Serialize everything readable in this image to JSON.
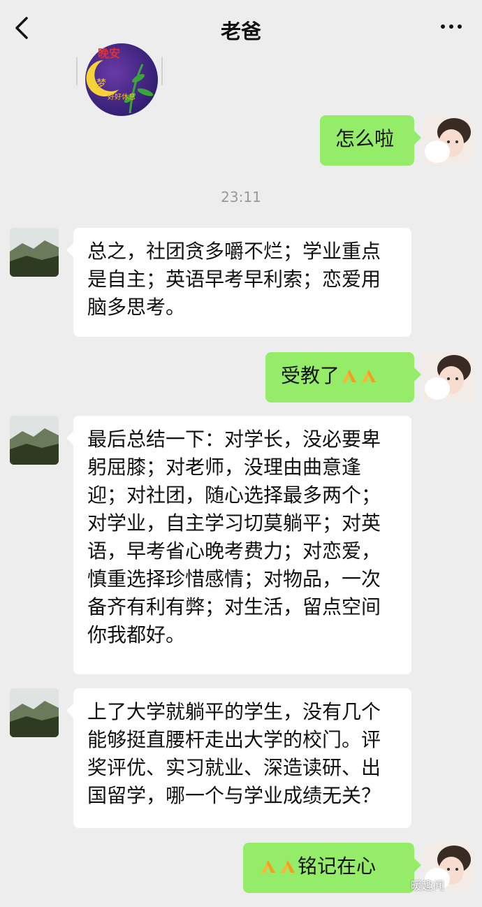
{
  "header": {
    "title": "老爸",
    "back_icon": "chevron-left-icon",
    "more_icon": "more-dots-icon"
  },
  "sticker": {
    "text_main": "晚安",
    "text_side": "好好休息",
    "text_side2": "梦"
  },
  "timestamp": "23:11",
  "messages": [
    {
      "side": "out",
      "text": "怎么啦"
    },
    {
      "side": "in",
      "text": "总之，社团贪多嚼不烂；学业重点\n是自主；英语早考早利索；恋爱用\n脑多思考。"
    },
    {
      "side": "out",
      "text": "受教了",
      "emoji_after": "folded-hands-icon"
    },
    {
      "side": "in",
      "text": "最后总结一下：对学长，没必要卑\n躬屈膝；对老师，没理由曲意逢\n迎；对社团，随心选择最多两个；\n对学业，自主学习切莫躺平；对英\n语，早考省心晚考费力；对恋爱，\n慎重选择珍惜感情；对物品，一次\n备齐有利有弊；对生活，留点空间\n你我都好。"
    },
    {
      "side": "in",
      "text": "上了大学就躺平的学生，没有几个\n能够挺直腰杆走出大学的校门。评\n奖评优、实习就业、深造读研、出\n国留学，哪一个与学业成绩无关？"
    },
    {
      "side": "out",
      "text": "铭记在心",
      "emoji_before": "folded-hands-icon"
    }
  ],
  "watermark": "暖趣闻",
  "colors": {
    "background": "#ededed",
    "incoming_bubble": "#ffffff",
    "outgoing_bubble": "#95ec69"
  }
}
